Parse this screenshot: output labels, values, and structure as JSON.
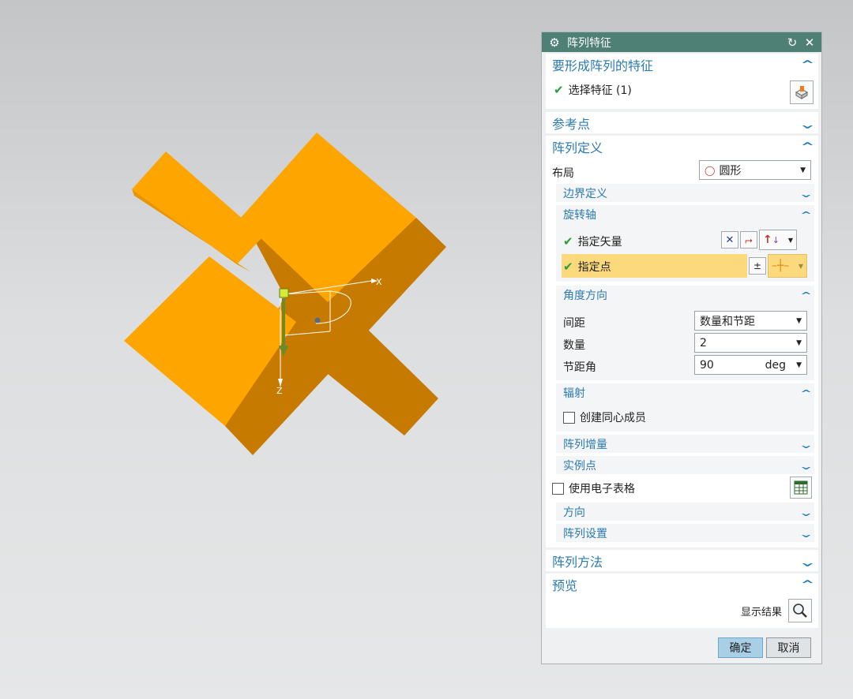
{
  "viewport": {
    "axis_x_label": "X",
    "axis_z_label": "Z",
    "part_color": "#ffa500",
    "part_shadow_color": "#c77a00"
  },
  "dialog": {
    "title": "阵列特征",
    "title_bar_color": "#4e8076",
    "sections": {
      "features": {
        "header": "要形成阵列的特征",
        "select_label": "选择特征 (1)"
      },
      "reference_point": {
        "header": "参考点"
      },
      "pattern_definition": {
        "header": "阵列定义",
        "layout_label": "布局",
        "layout_value": "圆形",
        "boundary": {
          "header": "边界定义"
        },
        "rotation_axis": {
          "header": "旋转轴",
          "specify_vector_label": "指定矢量",
          "specify_point_label": "指定点"
        },
        "angle_direction": {
          "header": "角度方向",
          "spacing_label": "间距",
          "spacing_value": "数量和节距",
          "count_label": "数量",
          "count_value": "2",
          "pitch_angle_label": "节距角",
          "pitch_angle_value": "90",
          "pitch_angle_unit": "deg"
        },
        "radiate": {
          "header": "辐射",
          "create_concentric_label": "创建同心成员"
        },
        "pattern_increment": {
          "header": "阵列增量"
        },
        "instance_points": {
          "header": "实例点"
        },
        "use_spreadsheet_label": "使用电子表格",
        "orientation": {
          "header": "方向"
        },
        "pattern_settings": {
          "header": "阵列设置"
        }
      },
      "pattern_method": {
        "header": "阵列方法"
      },
      "preview": {
        "header": "预览",
        "show_result_label": "显示结果"
      }
    },
    "ok_label": "确定",
    "cancel_label": "取消"
  }
}
